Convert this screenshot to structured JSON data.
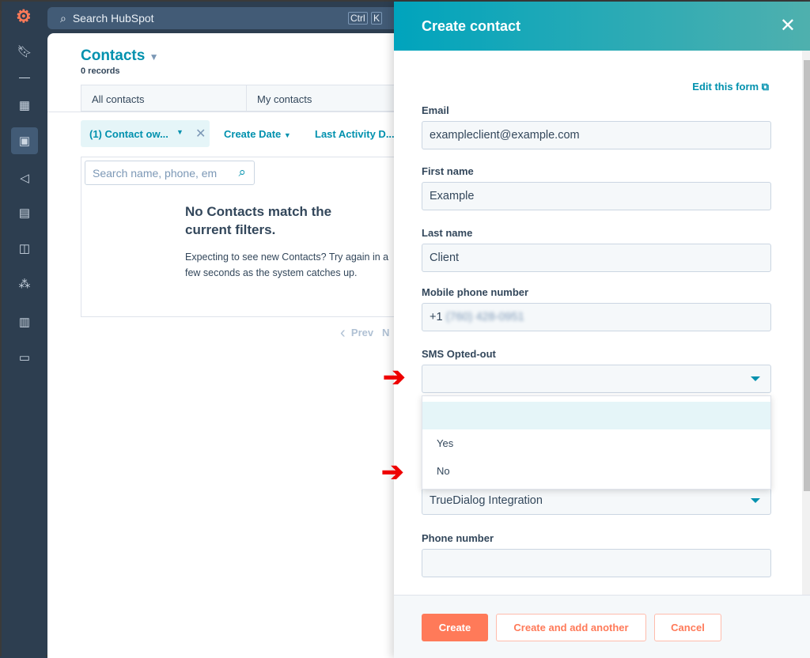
{
  "nav": {
    "search_placeholder": "Search HubSpot",
    "kbd1": "Ctrl",
    "kbd2": "K"
  },
  "sidebar": {
    "icons": [
      "bookmark-icon",
      "dashboard-icon",
      "contacts-icon",
      "marketing-icon",
      "content-icon",
      "commerce-icon",
      "automation-icon",
      "reports-icon",
      "folder-icon"
    ]
  },
  "main": {
    "title": "Contacts",
    "records": "0 records",
    "tabs": [
      "All contacts",
      "My contacts"
    ],
    "filters": {
      "chip": "(1) Contact ow...",
      "create_date": "Create Date",
      "last_activity": "Last Activity D..."
    },
    "search_placeholder": "Search name, phone, em",
    "empty_title": "No Contacts match the current filters.",
    "empty_text": "Expecting to see new Contacts? Try again in a few seconds as the system catches up.",
    "prev": "Prev",
    "next": "N"
  },
  "panel": {
    "title": "Create contact",
    "edit_form": "Edit this form",
    "fields": {
      "email_label": "Email",
      "email": "exampleclient@example.com",
      "first_label": "First name",
      "first": "Example",
      "last_label": "Last name",
      "last": "Client",
      "mobile_label": "Mobile phone number",
      "mobile_prefix": "+1",
      "mobile_blurred": "(760) 428-0951",
      "sms_label": "SMS Opted-out",
      "integration": "TrueDialog Integration",
      "phone_label": "Phone number"
    },
    "dropdown_options": [
      "",
      "Yes",
      "No"
    ],
    "buttons": {
      "create": "Create",
      "create_another": "Create and add another",
      "cancel": "Cancel"
    }
  },
  "colors": {
    "accent": "#0091ae",
    "primary_button": "#ff7a59",
    "sidebar": "#2d3e50",
    "annotation_arrow": "#e00000"
  }
}
